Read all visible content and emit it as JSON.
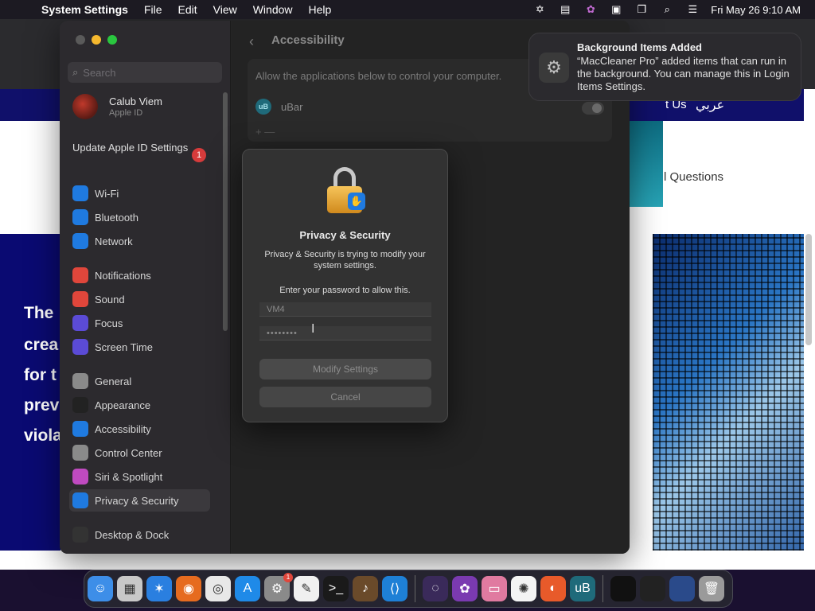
{
  "menubar": {
    "app_name": "System Settings",
    "menus": [
      "File",
      "Edit",
      "View",
      "Window",
      "Help"
    ],
    "clock": "Fri May 26  9:10 AM"
  },
  "background_page": {
    "nav_link_partial": "t Us",
    "nav_link_arabic": "عربي",
    "faq_partial": "l Questions",
    "left_text_lines": [
      "The",
      "crea",
      "for t",
      "prev",
      "viola"
    ]
  },
  "sidebar": {
    "search_placeholder": "Search",
    "profile_name": "Calub Viem",
    "profile_sub": "Apple ID",
    "update_label": "Update Apple ID Settings",
    "update_badge": "1",
    "items": [
      {
        "label": "Wi-Fi",
        "color": "#1f7ae0",
        "icon": "wifi-icon"
      },
      {
        "label": "Bluetooth",
        "color": "#1f7ae0",
        "icon": "bluetooth-icon"
      },
      {
        "label": "Network",
        "color": "#1f7ae0",
        "icon": "globe-icon"
      },
      {
        "label": "Notifications",
        "color": "#e0463b",
        "icon": "bell-icon"
      },
      {
        "label": "Sound",
        "color": "#e0463b",
        "icon": "speaker-icon"
      },
      {
        "label": "Focus",
        "color": "#5b4bd6",
        "icon": "moon-icon"
      },
      {
        "label": "Screen Time",
        "color": "#5b4bd6",
        "icon": "hourglass-icon"
      },
      {
        "label": "General",
        "color": "#8a8a8a",
        "icon": "gear-icon"
      },
      {
        "label": "Appearance",
        "color": "#222222",
        "icon": "appearance-icon"
      },
      {
        "label": "Accessibility",
        "color": "#1f7ae0",
        "icon": "accessibility-icon"
      },
      {
        "label": "Control Center",
        "color": "#8a8a8a",
        "icon": "control-center-icon"
      },
      {
        "label": "Siri & Spotlight",
        "color": "#c04ac0",
        "icon": "siri-icon"
      },
      {
        "label": "Privacy & Security",
        "color": "#1f7ae0",
        "icon": "hand-icon"
      },
      {
        "label": "Desktop & Dock",
        "color": "#333333",
        "icon": "dock-icon"
      }
    ]
  },
  "content": {
    "title": "Accessibility",
    "description": "Allow the applications below to control your computer.",
    "app_name": "uBar",
    "app_icon_text": "uB",
    "add_remove": "+  —"
  },
  "dialog": {
    "title": "Privacy & Security",
    "message": "Privacy & Security is trying to modify your system settings.",
    "prompt": "Enter your password to allow this.",
    "username_value": "VM4",
    "password_value": "••••••••",
    "modify_label": "Modify Settings",
    "cancel_label": "Cancel"
  },
  "notification": {
    "title": "Background Items Added",
    "body": "“MacCleaner Pro” added items that can run in the background. You can manage this in Login Items Settings."
  },
  "dock": {
    "apps": [
      {
        "name": "finder-icon",
        "color": "#3d8ee8",
        "glyph": "☺"
      },
      {
        "name": "launchpad-icon",
        "color": "#c8c8c8",
        "glyph": "▦"
      },
      {
        "name": "safari-icon",
        "color": "#2a7fe0",
        "glyph": "✶"
      },
      {
        "name": "firefox-icon",
        "color": "#e66b1f",
        "glyph": "◉"
      },
      {
        "name": "chrome-icon",
        "color": "#e8e8e8",
        "glyph": "◎"
      },
      {
        "name": "app-store-icon",
        "color": "#1f8ae8",
        "glyph": "A"
      },
      {
        "name": "system-settings-icon",
        "color": "#8a8a8a",
        "glyph": "⚙",
        "badge": "1"
      },
      {
        "name": "textedit-icon",
        "color": "#f0f0f0",
        "glyph": "✎"
      },
      {
        "name": "terminal-icon",
        "color": "#1a1a1a",
        "glyph": ">_"
      },
      {
        "name": "garageband-icon",
        "color": "#6a4a2a",
        "glyph": "♪"
      },
      {
        "name": "vscode-icon",
        "color": "#1e80d6",
        "glyph": "⟨⟩"
      },
      {
        "name": "sep",
        "color": "",
        "glyph": ""
      },
      {
        "name": "orbit-icon",
        "color": "#3a2a5a",
        "glyph": "◌"
      },
      {
        "name": "setapp-icon",
        "color": "#7a3ab0",
        "glyph": "✿"
      },
      {
        "name": "screen-icon",
        "color": "#e07aa0",
        "glyph": "▭"
      },
      {
        "name": "photos-icon",
        "color": "#f4f4f4",
        "glyph": "✺"
      },
      {
        "name": "duckduckgo-icon",
        "color": "#e85a2a",
        "glyph": "◐"
      },
      {
        "name": "ubar-icon",
        "color": "#1f6a7a",
        "glyph": "uB"
      },
      {
        "name": "sep",
        "color": "",
        "glyph": ""
      },
      {
        "name": "window-thumb-icon",
        "color": "#111111",
        "glyph": ""
      },
      {
        "name": "window-thumb-icon",
        "color": "#222222",
        "glyph": ""
      },
      {
        "name": "window-thumb-icon",
        "color": "#2a4a8a",
        "glyph": ""
      },
      {
        "name": "trash-icon",
        "color": "#9a9a9a",
        "glyph": "🗑"
      }
    ]
  }
}
